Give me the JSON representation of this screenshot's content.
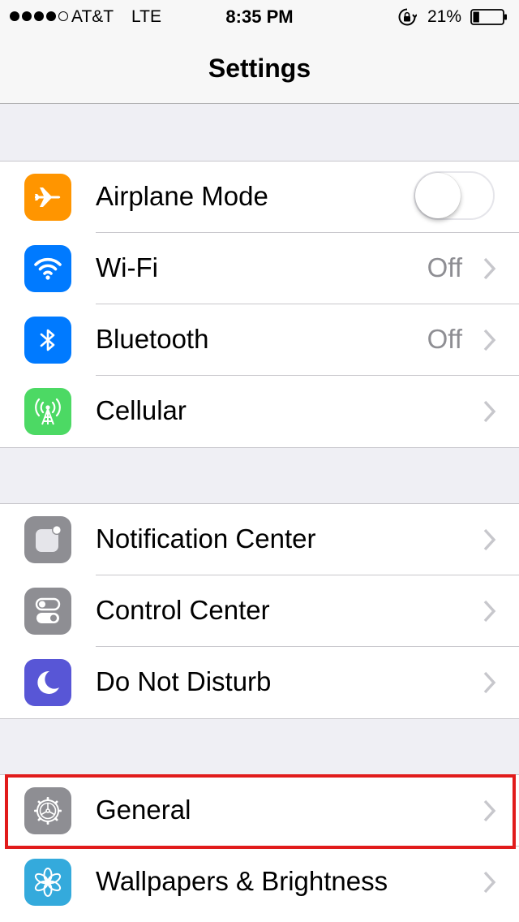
{
  "status_bar": {
    "carrier": "AT&T",
    "network": "LTE",
    "time": "8:35 PM",
    "battery_percent": "21%",
    "battery_level": 0.21,
    "signal_bars_filled": 4
  },
  "nav": {
    "title": "Settings"
  },
  "groups": [
    {
      "items": [
        {
          "label": "Airplane Mode",
          "icon": "airplane-icon",
          "icon_color": "#ff9500",
          "control": "toggle",
          "toggle_on": false
        },
        {
          "label": "Wi-Fi",
          "icon": "wifi-icon",
          "icon_color": "#007aff",
          "value": "Off"
        },
        {
          "label": "Bluetooth",
          "icon": "bluetooth-icon",
          "icon_color": "#007aff",
          "value": "Off"
        },
        {
          "label": "Cellular",
          "icon": "cellular-icon",
          "icon_color": "#4cd964"
        }
      ]
    },
    {
      "items": [
        {
          "label": "Notification Center",
          "icon": "notification-center-icon",
          "icon_color": "#8e8e93"
        },
        {
          "label": "Control Center",
          "icon": "control-center-icon",
          "icon_color": "#8e8e93"
        },
        {
          "label": "Do Not Disturb",
          "icon": "moon-icon",
          "icon_color": "#5856d6"
        }
      ]
    },
    {
      "items": [
        {
          "label": "General",
          "icon": "gear-icon",
          "icon_color": "#8e8e93",
          "highlighted": true
        },
        {
          "label": "Wallpapers & Brightness",
          "icon": "flower-icon",
          "icon_color": "#34aadc"
        }
      ]
    }
  ],
  "colors": {
    "highlight": "#e11b1b",
    "background": "#efeff4",
    "secondary_text": "#8e8e93"
  }
}
